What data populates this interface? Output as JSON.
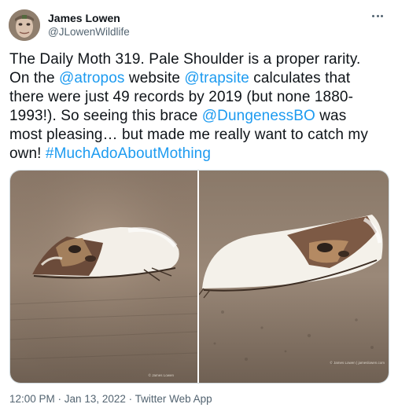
{
  "author": {
    "name": "James Lowen",
    "handle": "@JLowenWildlife"
  },
  "tweet": {
    "line1": [
      {
        "t": "The Daily Moth 319. Pale Shoulder is a proper rarity."
      }
    ],
    "line2": [
      {
        "t": "On the "
      },
      {
        "t": "@atropos",
        "link": true
      },
      {
        "t": " website "
      },
      {
        "t": "@trapsite",
        "link": true
      },
      {
        "t": " calculates that"
      }
    ],
    "line3": [
      {
        "t": "there were just 49 records by 2019 (but none 1880-"
      }
    ],
    "line4": [
      {
        "t": "1993!). So seeing this brace "
      },
      {
        "t": "@DungenessBO",
        "link": true
      },
      {
        "t": " was"
      }
    ],
    "line5": [
      {
        "t": "most pleasing… but made me really want to catch my"
      }
    ],
    "line6": [
      {
        "t": "own! "
      },
      {
        "t": "#MuchAdoAboutMothing",
        "link": true
      }
    ]
  },
  "media": {
    "left_credit": "© James Lowen",
    "right_credit": "© James Lowen | jameslowen.com"
  },
  "meta": {
    "time": "12:00 PM",
    "date": "Jan 13, 2022",
    "source": "Twitter Web App",
    "separator": " · "
  },
  "colors": {
    "link": "#1d9bf0",
    "secondary": "#536471",
    "text": "#0f1419"
  }
}
